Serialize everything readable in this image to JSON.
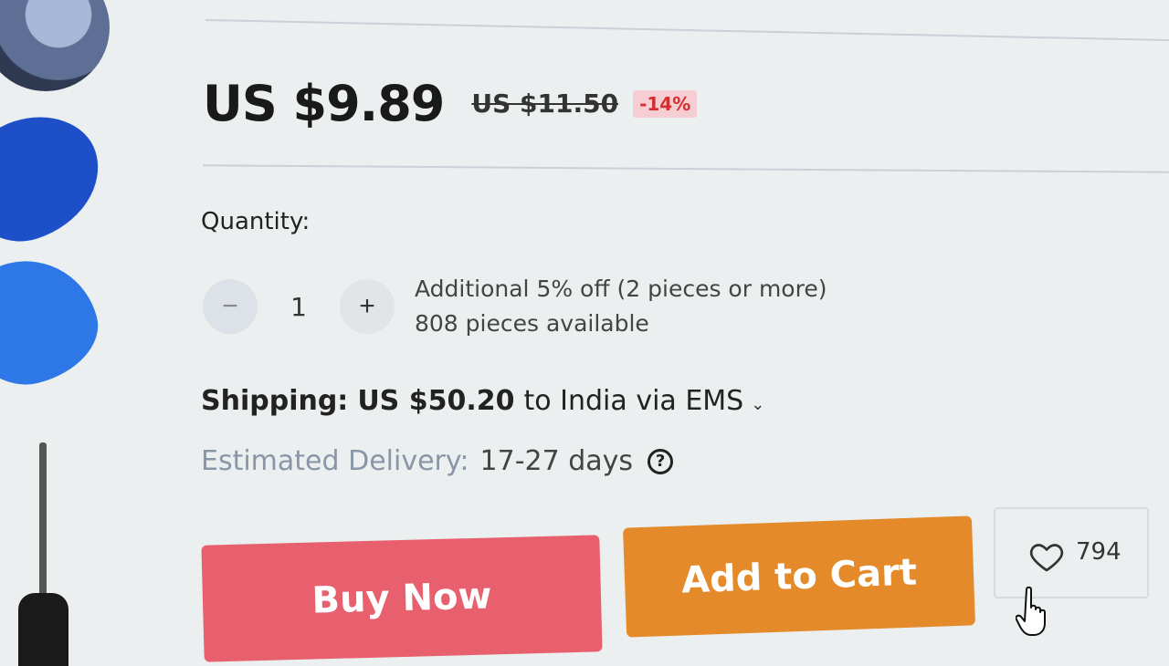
{
  "price": {
    "current": "US $9.89",
    "original": "US $11.50",
    "discount": "-14%"
  },
  "quantity": {
    "label": "Quantity:",
    "value": "1",
    "decrement_symbol": "−",
    "increment_symbol": "+",
    "promo": "Additional 5% off (2 pieces or more)",
    "available": "808 pieces available"
  },
  "shipping": {
    "label": "Shipping:",
    "cost": "US $50.20",
    "destination": "to India via EMS",
    "chevron": "⌄"
  },
  "delivery": {
    "label": "Estimated Delivery:",
    "days": "17-27 days",
    "help": "?"
  },
  "actions": {
    "buy_now": "Buy Now",
    "add_to_cart": "Add to Cart"
  },
  "wishlist": {
    "count": "794",
    "icon": "heart-icon"
  },
  "colors": {
    "buy_now": "#e8606e",
    "add_to_cart": "#e48a2a",
    "discount_text": "#d32f2f",
    "discount_bg": "#f6cdd2"
  }
}
